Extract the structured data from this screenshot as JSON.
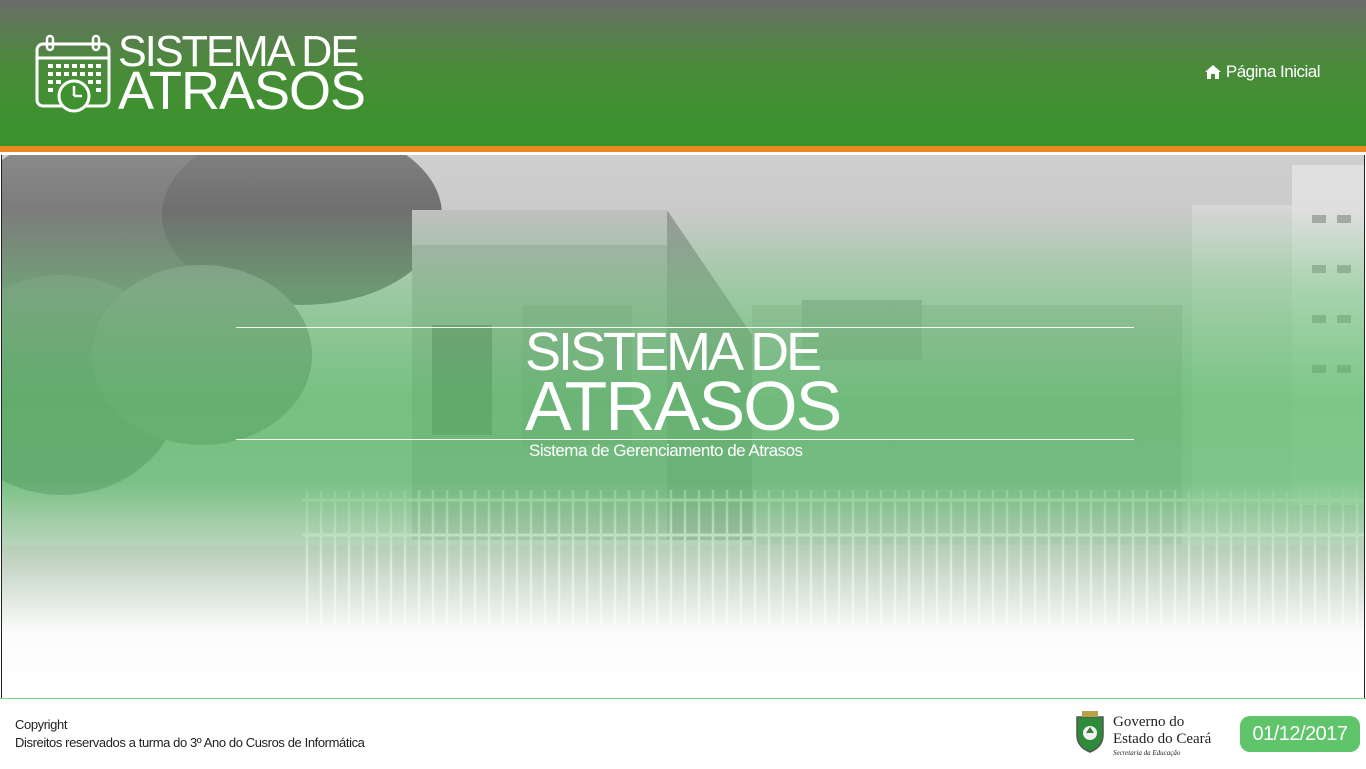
{
  "header": {
    "logo": {
      "line1": "SISTEMA DE",
      "line2": "ATRASOS",
      "icon": "calendar-clock-icon"
    },
    "nav": {
      "home_label": "Página Inicial",
      "home_icon": "home-icon"
    }
  },
  "hero": {
    "title_line1": "SISTEMA DE",
    "title_line2": "ATRASOS",
    "subtitle": "Sistema de Gerenciamento de Atrasos"
  },
  "footer": {
    "copyright_label": "Copyright",
    "copyright_text": "Disreitos reservados a turma do 3º Ano do Cusros de Informática",
    "gov_logo": {
      "line1": "Governo do",
      "line2": "Estado do Ceará",
      "line3": "Secretaria da Educação"
    },
    "date": "01/12/2017"
  },
  "colors": {
    "header_green": "#3f9130",
    "accent_orange": "#ec8a22",
    "badge_green": "#5fc46a"
  }
}
